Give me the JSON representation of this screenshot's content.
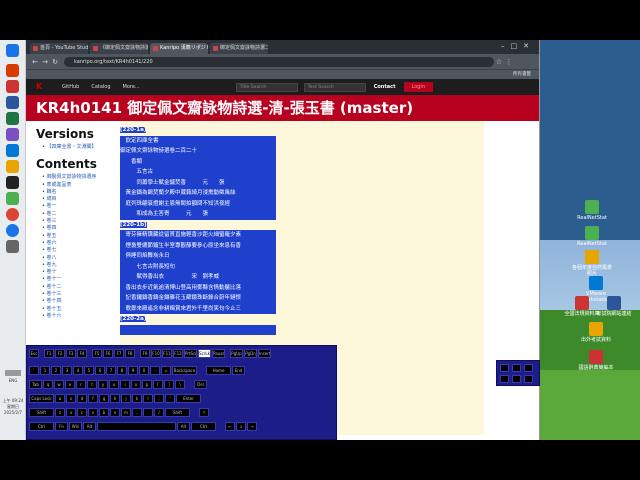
{
  "browser": {
    "tabs": [
      {
        "label": "首頁 - YouTube Studio",
        "active": false
      },
      {
        "label": "《御定佩文齋詠物詩選》清玉...",
        "active": false
      },
      {
        "label": "Kanripo 漢籍リポジトリ : KR4...",
        "active": true
      },
      {
        "label": "御定佩文齋詠物詩選二百十...",
        "active": false
      }
    ],
    "url": "kanripo.org/text/KR4h0141/220",
    "bookmarks_right": "所有書籤"
  },
  "site": {
    "nav": {
      "github": "GitHub",
      "catalog": "Catalog",
      "more": "More...",
      "title_search": "Title Search",
      "text_search": "Text Search",
      "contact": "Contact",
      "login": "Login"
    },
    "page_title": "KR4h0141 御定佩文齋詠物詩選-清-張玉書 (master)"
  },
  "sidebar": {
    "versions_heading": "Versions",
    "versions": [
      "【四庫全書・文淵閣】"
    ],
    "contents_heading": "Contents",
    "contents": [
      "御製佩文齋詠物詩選序",
      "表或進呈表",
      "職名",
      "總目",
      "卷一",
      "卷二",
      "卷三",
      "卷四",
      "卷五",
      "卷六",
      "卷七",
      "卷八",
      "卷九",
      "卷十",
      "卷十一",
      "卷十二",
      "卷十三",
      "卷十四",
      "卷十五",
      "卷十六"
    ]
  },
  "text": {
    "lines": [
      {
        "t": "[220-1a]",
        "pb": true
      },
      {
        "t": "　欽定四庫全書",
        "pb": false
      },
      {
        "t": "御定佩文齋詠物詩選卷二百二十",
        "pb": false
      },
      {
        "t": "　　香類",
        "pb": false
      },
      {
        "t": "　　　五言古",
        "pb": false
      },
      {
        "t": "　　　同蕭學士賦金鑪焚香　　　元　　張",
        "pb": false
      },
      {
        "t": "　黃金鑄為鵲焚蘭夕殿中葳蕤綺月浸熏動徵風絲",
        "pb": false
      },
      {
        "t": "　庭列珠翩衰燈謝主恩無聞拍額問不知洪夜經",
        "pb": false
      },
      {
        "t": "　　　和成為主答寄　　　元　　張",
        "pb": false
      },
      {
        "t": "[220-1b]",
        "pb": true
      },
      {
        "t": "　寄芬擁精靄藏從留貫直施輕香沙距火細螢羅夕素",
        "pb": false
      },
      {
        "t": "　煙裊雙纏節鑪生半室專觀靜要參心原坐來息有香",
        "pb": false
      },
      {
        "t": "　俱睡同焰舞炭永日",
        "pb": false
      },
      {
        "t": "　　　七言古附長短句",
        "pb": false
      },
      {
        "t": "　　　賦得香出衣　　　　　宋　劉孝威",
        "pb": false
      },
      {
        "t": "　香出衣步近氣逾清博山登高用鄧縣含情動靨比落",
        "pb": false
      },
      {
        "t": "　記香鑼鑄香鑄金鑲雜花玉篩鏡珠斷錄合蔚年鏈恨",
        "pb": false
      },
      {
        "t": "　歌鄭來殿遙念非耕燭賞來君外千里尚笑句今止三",
        "pb": false
      },
      {
        "t": "[220-2a]",
        "pb": true
      },
      {
        "t": "　　",
        "pb": false
      }
    ]
  },
  "keyboard": {
    "rows": [
      [
        "Esc",
        "",
        "F1",
        "F2",
        "F3",
        "F4",
        "",
        "F5",
        "F6",
        "F7",
        "F8",
        "",
        "F9",
        "F10",
        "F11",
        "F12",
        "PrtScn",
        "ScrLk",
        "Pause",
        "",
        "PgUp",
        "PgDn",
        "Insert"
      ],
      [
        "`",
        "1",
        "2",
        "3",
        "4",
        "5",
        "6",
        "7",
        "8",
        "9",
        "0",
        "-",
        "=",
        "Backspace",
        "",
        "Home",
        "End"
      ],
      [
        "Tab",
        "q",
        "w",
        "e",
        "r",
        "t",
        "y",
        "u",
        "i",
        "o",
        "p",
        "[",
        "]",
        "\\",
        "",
        "Del"
      ],
      [
        "Caps Lock",
        "a",
        "s",
        "d",
        "f",
        "g",
        "h",
        "j",
        "k",
        "l",
        ";",
        "'",
        "Enter"
      ],
      [
        "Shift",
        "z",
        "x",
        "c",
        "v",
        "b",
        "n",
        "m",
        ",",
        ".",
        "/",
        "Shift",
        "",
        "↑"
      ],
      [
        "Ctrl",
        "Fn",
        "Win",
        "Alt",
        "",
        "Alt",
        "Ctrl",
        "",
        "←",
        "↓",
        "→"
      ]
    ],
    "active_key": "ScrLk"
  },
  "tray": {
    "lang": "ENG",
    "time": "上午 09:24",
    "weekday": "星期日",
    "date": "2025/2/7"
  },
  "desktop": {
    "icons": [
      "RealNetStat",
      "RealNetStat",
      "各個年度自然風景照片",
      "VMware Workstation",
      "全國法規資料庫",
      "考試院網站連結",
      "出外考試資料",
      "國語辭典簡編本"
    ]
  },
  "colors": {
    "site_red": "#b8001f",
    "highlight_blue": "#1e40cc",
    "text_bg": "#fdf8dc",
    "keyboard_bg": "#1d1d8a"
  }
}
